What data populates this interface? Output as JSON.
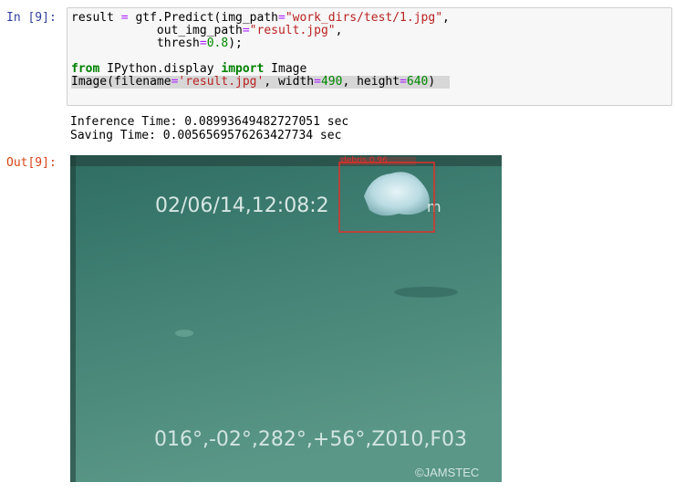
{
  "cell": {
    "in_prompt": "In [9]:",
    "out_prompt": "Out[9]:",
    "code_lines": [
      [
        {
          "t": "result ",
          "c": ""
        },
        {
          "t": "=",
          "c": "op"
        },
        {
          "t": " gtf.Predict(img_path",
          "c": ""
        },
        {
          "t": "=",
          "c": "op"
        },
        {
          "t": "\"work_dirs/test/1.jpg\"",
          "c": "str"
        },
        {
          "t": ",",
          "c": ""
        }
      ],
      [
        {
          "t": "            out_img_path",
          "c": ""
        },
        {
          "t": "=",
          "c": "op"
        },
        {
          "t": "\"result.jpg\"",
          "c": "str"
        },
        {
          "t": ",",
          "c": ""
        }
      ],
      [
        {
          "t": "            thresh",
          "c": ""
        },
        {
          "t": "=",
          "c": "op"
        },
        {
          "t": "0.8",
          "c": "num"
        },
        {
          "t": ");",
          "c": ""
        }
      ],
      [],
      [
        {
          "t": "from",
          "c": "kw"
        },
        {
          "t": " IPython.display ",
          "c": ""
        },
        {
          "t": "import",
          "c": "kw"
        },
        {
          "t": " Image",
          "c": ""
        }
      ],
      [
        {
          "t": "Image(filename",
          "c": ""
        },
        {
          "t": "=",
          "c": "op"
        },
        {
          "t": "'result.jpg'",
          "c": "str"
        },
        {
          "t": ", width",
          "c": ""
        },
        {
          "t": "=",
          "c": "op"
        },
        {
          "t": "490",
          "c": "num"
        },
        {
          "t": ", height",
          "c": ""
        },
        {
          "t": "=",
          "c": "op"
        },
        {
          "t": "640",
          "c": "num"
        },
        {
          "t": ")",
          "c": ""
        }
      ]
    ],
    "output_lines": [
      "Inference Time: 0.08993649482727051 sec",
      "Saving Time: 0.0056569576263427734 sec"
    ],
    "image": {
      "timestamp_overlay": "02/06/14,12:08:2",
      "timestamp_tail": "m",
      "detection_label": "debris,0.96",
      "coords_overlay": "016°,-02°,282°,+56°,Z010,F03",
      "watermark": "©JAMSTEC"
    }
  },
  "colors": {
    "in_prompt": "#303f9f",
    "out_prompt": "#d84315",
    "keyword": "#008000",
    "operator": "#aa22ff",
    "string": "#ba2121",
    "number": "#008800",
    "water": "#3d7a70",
    "bbox": "#e0302a"
  }
}
